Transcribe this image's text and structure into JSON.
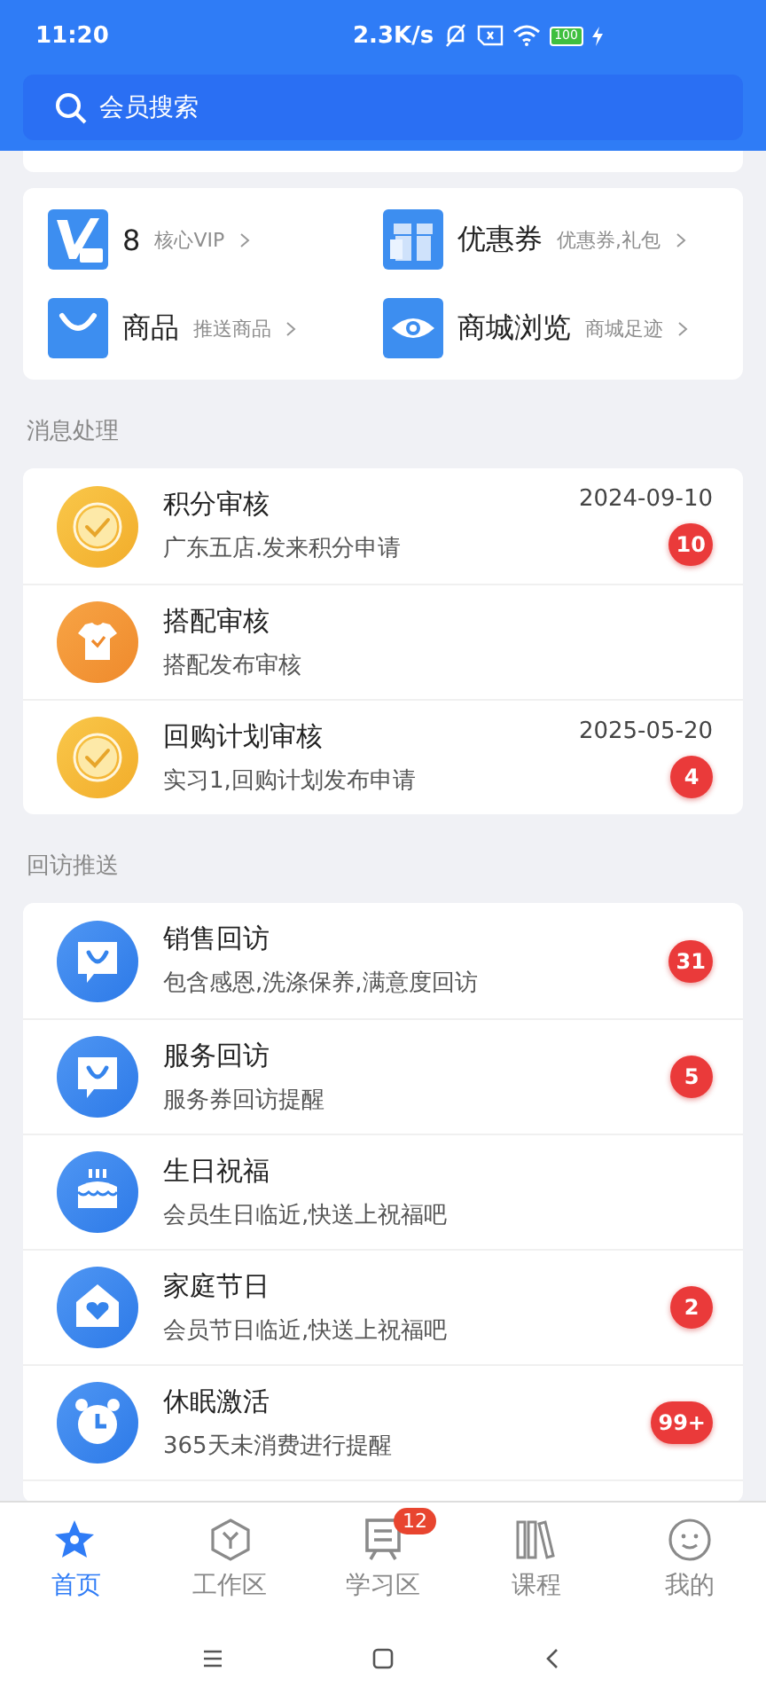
{
  "status_bar": {
    "time": "11:20",
    "speed": "2.3K/s",
    "battery": "100"
  },
  "search": {
    "placeholder": "会员搜索"
  },
  "quick_links": [
    {
      "kind": "vip",
      "title": "8",
      "hint": "核心VIP"
    },
    {
      "kind": "gift",
      "title": "优惠券",
      "hint": "优惠券,礼包"
    },
    {
      "kind": "bag",
      "title": "商品",
      "hint": "推送商品"
    },
    {
      "kind": "eye",
      "title": "商城浏览",
      "hint": "商城足迹"
    }
  ],
  "sections": [
    {
      "title": "消息处理",
      "items": [
        {
          "kind": "check",
          "title": "积分审核",
          "subtitle": "广东五店.发来积分申请",
          "date": "2024-09-10",
          "badge": "10"
        },
        {
          "kind": "shirt",
          "title": "搭配审核",
          "subtitle": "搭配发布审核"
        },
        {
          "kind": "check",
          "title": "回购计划审核",
          "subtitle": "实习1,回购计划发布申请",
          "date": "2025-05-20",
          "badge": "4"
        }
      ]
    },
    {
      "title": "回访推送",
      "items": [
        {
          "kind": "chat",
          "title": "销售回访",
          "subtitle": "包含感恩,洗涤保养,满意度回访",
          "badge": "31"
        },
        {
          "kind": "chat",
          "title": "服务回访",
          "subtitle": "服务券回访提醒",
          "badge": "5"
        },
        {
          "kind": "cake",
          "title": "生日祝福",
          "subtitle": "会员生日临近,快送上祝福吧"
        },
        {
          "kind": "house",
          "title": "家庭节日",
          "subtitle": "会员节日临近,快送上祝福吧",
          "badge": "2"
        },
        {
          "kind": "clock",
          "title": "休眠激活",
          "subtitle": "365天未消费进行提醒",
          "badge": "99+"
        }
      ]
    }
  ],
  "tabs": [
    {
      "kind": "home",
      "label": "首页",
      "selected": true
    },
    {
      "kind": "work",
      "label": "工作区",
      "selected": false
    },
    {
      "kind": "study",
      "label": "学习区",
      "selected": false,
      "badge": "12"
    },
    {
      "kind": "course",
      "label": "课程",
      "selected": false
    },
    {
      "kind": "me",
      "label": "我的",
      "selected": false
    }
  ]
}
